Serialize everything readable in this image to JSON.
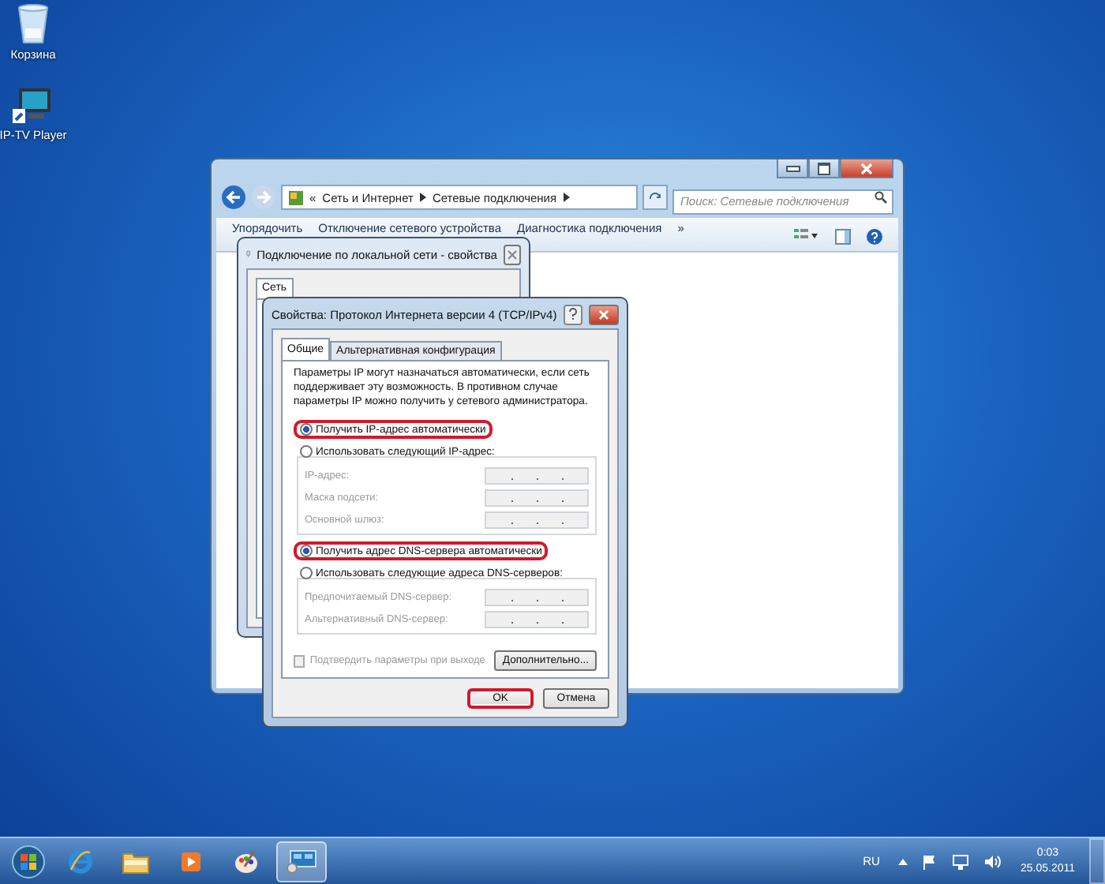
{
  "desktop_icons": [
    {
      "kind": "recycle-bin",
      "label": "Корзина"
    },
    {
      "kind": "tv",
      "label": "IP-TV Player"
    }
  ],
  "explorer": {
    "address_prefix": "«",
    "breadcrumb": [
      "Сеть и Интернет",
      "Сетевые подключения"
    ],
    "search": {
      "placeholder": "Поиск: Сетевые подключения"
    },
    "toolbar": [
      "Упорядочить",
      "Отключение сетевого устройства",
      "Диагностика подключения",
      "»"
    ]
  },
  "lan_dialog": {
    "title": "Подключение по локальной сети - свойства",
    "tabs": [
      {
        "label": "Сеть",
        "selected": true
      }
    ]
  },
  "ipv4_dialog": {
    "title": "Свойства: Протокол Интернета версии 4 (TCP/IPv4)",
    "tabs": [
      {
        "label": "Общие",
        "selected": true
      },
      {
        "label": "Альтернативная конфигурация",
        "selected": false
      }
    ],
    "description": "Параметры IP могут назначаться автоматически, если сеть поддерживает эту возможность. В противном случае параметры IP можно получить у сетевого администратора.",
    "ip_options": [
      {
        "label": "Получить IP-адрес автоматически",
        "selected": true,
        "highlighted": true
      },
      {
        "label": "Использовать следующий IP-адрес:",
        "selected": false,
        "highlighted": false
      }
    ],
    "ip_fields": [
      {
        "label": "IP-адрес:",
        "disabled": true
      },
      {
        "label": "Маска подсети:",
        "disabled": true
      },
      {
        "label": "Основной шлюз:",
        "disabled": true
      }
    ],
    "dns_options": [
      {
        "label": "Получить адрес DNS-сервера автоматически",
        "selected": true,
        "highlighted": true
      },
      {
        "label": "Использовать следующие адреса DNS-серверов:",
        "selected": false,
        "highlighted": false
      }
    ],
    "dns_fields": [
      {
        "label": "Предпочитаемый DNS-сервер:",
        "disabled": true
      },
      {
        "label": "Альтернативный DNS-сервер:",
        "disabled": true
      }
    ],
    "validate": {
      "label": "Подтвердить параметры при выходе",
      "checked": false,
      "disabled": true
    },
    "advanced_button": "Дополнительно...",
    "buttons": [
      {
        "label": "OK",
        "highlighted": true
      },
      {
        "label": "Отмена",
        "highlighted": false
      }
    ]
  },
  "taskbar": {
    "apps": [
      {
        "kind": "ie",
        "selected": false
      },
      {
        "kind": "folder",
        "selected": false
      },
      {
        "kind": "media",
        "selected": false
      },
      {
        "kind": "paint",
        "selected": false
      },
      {
        "kind": "network",
        "selected": true
      }
    ],
    "language": "RU",
    "time": "0:03",
    "date": "25.05.2011"
  }
}
